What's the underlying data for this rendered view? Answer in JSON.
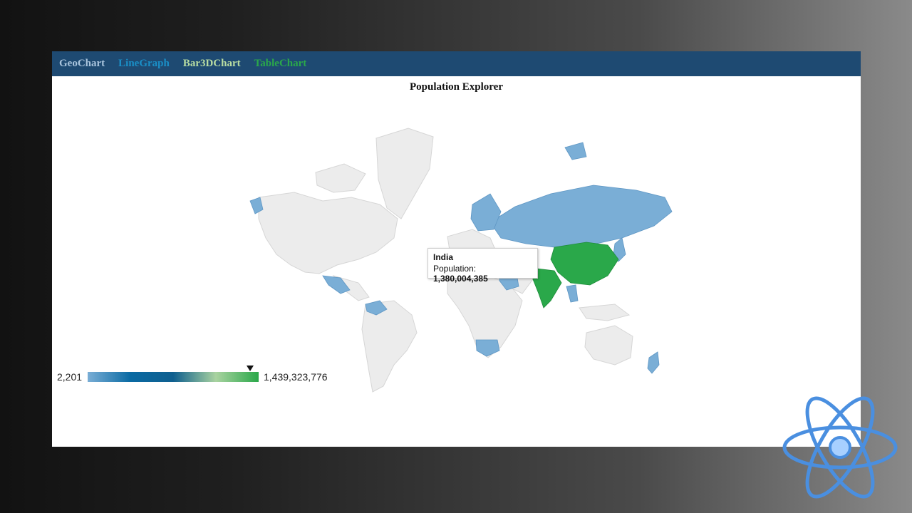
{
  "nav": {
    "items": [
      {
        "label": "GeoChart",
        "color": "#a9c4dd"
      },
      {
        "label": "LineGraph",
        "color": "#1a8fc7"
      },
      {
        "label": "Bar3DChart",
        "color": "#b8dca2"
      },
      {
        "label": "TableChart",
        "color": "#2aa84a"
      }
    ]
  },
  "page_title": "Population Explorer",
  "legend": {
    "min_label": "2,201",
    "max_label": "1,439,323,776",
    "marker_fraction": 0.95,
    "gradient": [
      "#7aaed6",
      "#0a6aa3",
      "#0f5f8f",
      "#a9d3a0",
      "#2aa84a"
    ]
  },
  "tooltip": {
    "country": "India",
    "metric_label": "Population:",
    "metric_value": "1,380,004,385"
  },
  "map": {
    "highlighted_countries": [
      "China",
      "India"
    ],
    "highlight_color": "#2aa84a",
    "data_color": "#7aaed6",
    "no_data_color": "#ececec"
  },
  "colors": {
    "navbar": "#1e4a72",
    "react_logo": "#4a8fe0"
  }
}
